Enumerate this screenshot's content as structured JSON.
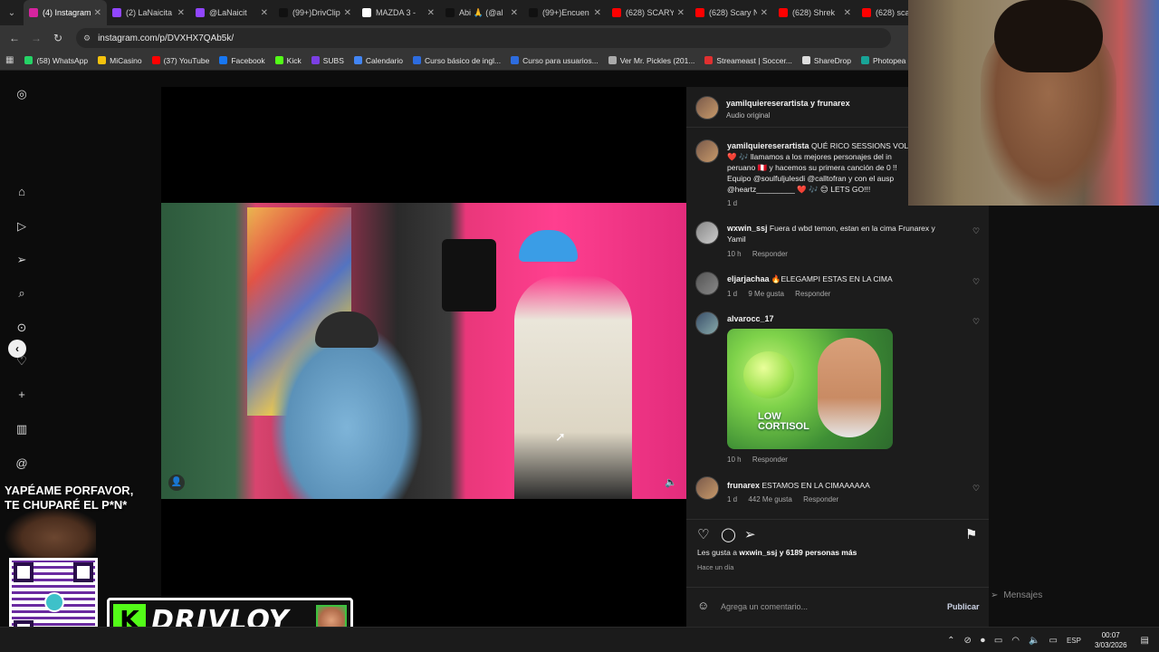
{
  "browser": {
    "tabs": [
      {
        "label": "(4) Instagram",
        "color": "#d6249f",
        "active": true
      },
      {
        "label": "(2) LaNaicita",
        "color": "#9146ff",
        "active": false
      },
      {
        "label": "@LaNaicit",
        "color": "#9146ff",
        "active": false
      },
      {
        "label": "(99+)DrivClip",
        "color": "#111111",
        "active": false
      },
      {
        "label": "MAZDA 3 - ",
        "color": "#ffffff",
        "active": false
      },
      {
        "label": "Abi 🙏 (@al",
        "color": "#111111",
        "active": false
      },
      {
        "label": "(99+)Encuen",
        "color": "#111111",
        "active": false
      },
      {
        "label": "(628) SCARY",
        "color": "#ff0000",
        "active": false
      },
      {
        "label": "(628) Scary N",
        "color": "#ff0000",
        "active": false
      },
      {
        "label": "(628) Shrek",
        "color": "#ff0000",
        "active": false
      },
      {
        "label": "(628) sca",
        "color": "#ff0000",
        "active": false
      }
    ],
    "url": "instagram.com/p/DVXHX7QAb5k/",
    "bookmarks": [
      {
        "label": "(58) WhatsApp",
        "color": "#25d366"
      },
      {
        "label": "MiCasino",
        "color": "#f4c20d"
      },
      {
        "label": "(37) YouTube",
        "color": "#ff0000"
      },
      {
        "label": "Facebook",
        "color": "#1877f2"
      },
      {
        "label": "Kick",
        "color": "#53fc18"
      },
      {
        "label": "SUBS",
        "color": "#7b3fe4"
      },
      {
        "label": "Calendario",
        "color": "#4285f4"
      },
      {
        "label": "Curso básico de ingl...",
        "color": "#2d6cdf"
      },
      {
        "label": "Curso para usuarios...",
        "color": "#2d6cdf"
      },
      {
        "label": "Ver Mr. Pickles (201...",
        "color": "#aaaaaa"
      },
      {
        "label": "Streameast | Soccer...",
        "color": "#e03030"
      },
      {
        "label": "ShareDrop",
        "color": "#dddddd"
      },
      {
        "label": "Photopea | Online",
        "color": "#18a497"
      }
    ]
  },
  "post": {
    "author": "yamilquiereserartista",
    "coauthor_line": "yamilquiereserartista y frunarex",
    "audio": "Audio original",
    "caption_user": "yamilquiereserartista",
    "caption_lines": [
      "QUÉ RICO SESSIONS VOL.",
      "❤️ 🎶 llamamos a los mejores personajes del in",
      "peruano 🇵🇪 y hacemos su primera canción de 0 !!",
      "Equipo @soulfuljulesdi @calltofran y con el ausp",
      "@heartz_________ ❤️ 🎶 😊 LETS GO!!!"
    ],
    "caption_time": "1 d",
    "comments": [
      {
        "user": "wxwin_ssj",
        "text": "Fuera d wbd temon, estan en la cima Frunarex y Yamil",
        "time": "10 h",
        "likes": "",
        "reply": "Responder"
      },
      {
        "user": "eljarjachaa",
        "text": "🔥ELEGAMPI ESTAS EN LA CIMA",
        "time": "1 d",
        "likes": "9 Me gusta",
        "reply": "Responder"
      },
      {
        "user": "alvarocc_17",
        "text": "",
        "time": "10 h",
        "likes": "",
        "reply": "Responder",
        "image_text": "LOW CORTISOL"
      },
      {
        "user": "frunarex",
        "text": "ESTAMOS EN LA CIMAAAAAA",
        "time": "1 d",
        "likes": "442 Me gusta",
        "reply": "Responder"
      }
    ],
    "likes_line_prefix": "Les gusta a",
    "likes_user": "wxwin_ssj",
    "likes_rest": "y 6189 personas más",
    "posted": "Hace un día",
    "comment_placeholder": "Agrega un comentario...",
    "publish": "Publicar"
  },
  "messages_label": "Mensajes",
  "overlay": {
    "yape_line1": "YAPÉAME PORFAVOR,",
    "yape_line2": "TE CHUPARÉ  EL P*N*",
    "brand": "DRIVLOY",
    "kick_letter": "K"
  },
  "taskbar": {
    "lang": "ESP",
    "time": "00:07",
    "date": "3/03/2026"
  }
}
